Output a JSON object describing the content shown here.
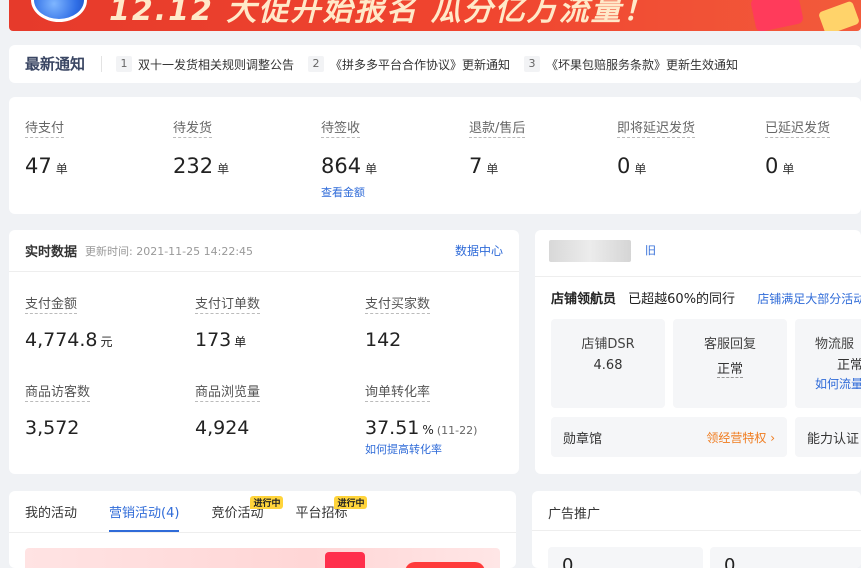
{
  "banner": {
    "text": "12.12 大促开始报名 瓜分亿万流量！"
  },
  "notice": {
    "title": "最新通知",
    "items": [
      {
        "num": "1",
        "text": "双十一发货相关规则调整公告"
      },
      {
        "num": "2",
        "text": "《拼多多平台合作协议》更新通知"
      },
      {
        "num": "3",
        "text": "《坏果包赔服务条款》更新生效通知"
      }
    ]
  },
  "orders": [
    {
      "label": "待支付",
      "value": "47",
      "unit": "单"
    },
    {
      "label": "待发货",
      "value": "232",
      "unit": "单"
    },
    {
      "label": "待签收",
      "value": "864",
      "unit": "单",
      "link": "查看金额"
    },
    {
      "label": "退款/售后",
      "value": "7",
      "unit": "单"
    },
    {
      "label": "即将延迟发货",
      "value": "0",
      "unit": "单"
    },
    {
      "label": "已延迟发货",
      "value": "0",
      "unit": "单"
    }
  ],
  "realtime": {
    "title": "实时数据",
    "updated": "更新时间: 2021-11-25 14:22:45",
    "more": "数据中心",
    "metrics": [
      {
        "label": "支付金额",
        "value": "4,774.8",
        "unit": "元"
      },
      {
        "label": "支付订单数",
        "value": "173",
        "unit": "单"
      },
      {
        "label": "支付买家数",
        "value": "142"
      },
      {
        "label": "商品访客数",
        "value": "3,572"
      },
      {
        "label": "商品浏览量",
        "value": "4,924"
      },
      {
        "label": "询单转化率",
        "value": "37.51",
        "unit": "%",
        "sub": "(11-22)",
        "link": "如何提高转化率"
      }
    ]
  },
  "shop": {
    "tag": "旧",
    "navigator_label": "店铺领航员",
    "navigator_value": "已超越60%的同行",
    "navigator_hint": "店铺满足大部分活动",
    "tiles": [
      {
        "title": "店铺DSR",
        "value": "4.68"
      },
      {
        "title": "客服回复",
        "value": "正常"
      },
      {
        "title": "物流服",
        "value": "正常",
        "link": "如何流量"
      }
    ],
    "medal": {
      "label": "勋章馆",
      "action": "领经营特权 ›"
    },
    "ability": {
      "label": "能力认证"
    }
  },
  "activities": {
    "tabs": [
      {
        "label": "我的活动"
      },
      {
        "label": "营销活动(4)"
      },
      {
        "label": "竞价活动",
        "badge": "进行中"
      },
      {
        "label": "平台招标",
        "badge": "进行中"
      }
    ]
  },
  "ads": {
    "title": "广告推广",
    "values": [
      "0",
      "0"
    ]
  },
  "colors": {
    "accent": "#2f6bd8",
    "orange": "#f07c1f",
    "badge": "#ffd43b"
  }
}
